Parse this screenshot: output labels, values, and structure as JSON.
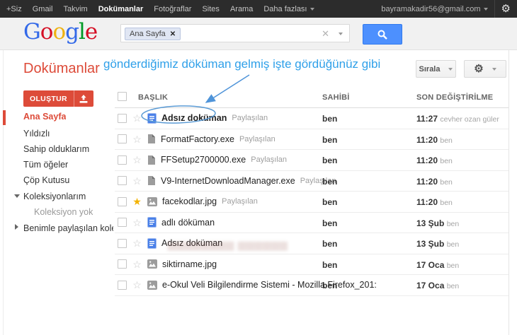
{
  "topbar": {
    "nav": [
      "+Siz",
      "Gmail",
      "Takvim",
      "Dokümanlar",
      "Fotoğraflar",
      "Sites",
      "Arama",
      "Daha fazlası"
    ],
    "account": "bayramakadir56@gmail.com",
    "gear_icon": "gear-icon"
  },
  "logo": {
    "letters": [
      "G",
      "o",
      "o",
      "g",
      "l",
      "e"
    ],
    "colors": [
      "#3369e8",
      "#d50f25",
      "#eeb211",
      "#3369e8",
      "#009925",
      "#d50f25"
    ]
  },
  "search": {
    "chip": "Ana Sayfa",
    "chip_remove": "✕",
    "clear": "✕"
  },
  "docs_header": {
    "title": "Dokümanlar",
    "sort_button": "Sırala"
  },
  "annotation": {
    "text": "gönderdiğimiz döküman gelmiş işte gördüğünüz gibi",
    "arrow_color": "#4f94d9",
    "ellipse_color": "#5b9bd5",
    "text_color": "#2fa0e9"
  },
  "sidebar": {
    "create_label": "OLUŞTUR",
    "items": [
      "Ana Sayfa",
      "Yıldızlı",
      "Sahip olduklarım",
      "Tüm öğeler",
      "Çöp Kutusu",
      "Koleksiyonlarım",
      "Koleksiyon yok",
      "Benimle paylaşılan koleksiy"
    ]
  },
  "table": {
    "columns": [
      "BAŞLIK",
      "SAHİBİ",
      "SON DEĞİŞTİRİLME"
    ],
    "rows": [
      {
        "title": "Adsız doküman",
        "shared": "Paylaşılan",
        "icon": "doc",
        "star": false,
        "bold": true,
        "owner": "ben",
        "modified": "11:27",
        "modified_by": "cevher ozan güler"
      },
      {
        "title": "FormatFactory.exe",
        "shared": "Paylaşılan",
        "icon": "file",
        "star": false,
        "bold": false,
        "owner": "ben",
        "modified": "11:20",
        "modified_by": "ben"
      },
      {
        "title": "FFSetup2700000.exe",
        "shared": "Paylaşılan",
        "icon": "file",
        "star": false,
        "bold": false,
        "owner": "ben",
        "modified": "11:20",
        "modified_by": "ben"
      },
      {
        "title": "V9-InternetDownloadManager.exe",
        "shared": "Paylaşılan",
        "icon": "file",
        "star": false,
        "bold": false,
        "owner": "ben",
        "modified": "11:20",
        "modified_by": "ben"
      },
      {
        "title": "facekodlar.jpg",
        "shared": "Paylaşılan",
        "icon": "image",
        "star": true,
        "bold": false,
        "owner": "ben",
        "modified": "11:20",
        "modified_by": "ben"
      },
      {
        "title": "adlı döküman",
        "shared": "",
        "icon": "doc",
        "star": false,
        "bold": false,
        "owner": "ben",
        "modified": "13 Şub",
        "modified_by": "ben"
      },
      {
        "title": "Adsız doküman",
        "shared": "",
        "icon": "doc",
        "star": false,
        "bold": false,
        "owner": "ben",
        "modified": "13 Şub",
        "modified_by": "ben"
      },
      {
        "title": "siktirname.jpg",
        "shared": "",
        "icon": "image",
        "star": false,
        "bold": false,
        "owner": "ben",
        "modified": "17 Oca",
        "modified_by": "ben"
      },
      {
        "title": "e-Okul Veli Bilgilendirme Sistemi - Mozilla Firefox_201:",
        "shared": "",
        "icon": "image",
        "star": false,
        "bold": false,
        "owner": "ben",
        "modified": "17 Oca",
        "modified_by": "ben"
      }
    ]
  },
  "watermark": "▆▆▆▆▆▆▆▆ ▆▆▆▆▆▆"
}
